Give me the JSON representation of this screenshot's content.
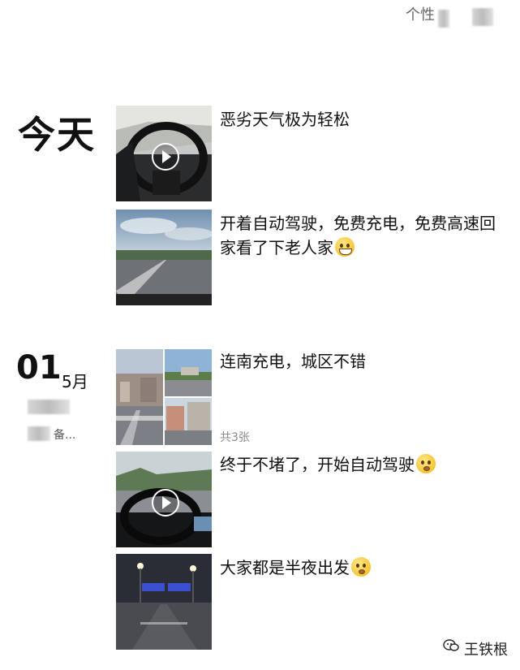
{
  "header": {
    "signature_label": "个性"
  },
  "sections": [
    {
      "day_label": "今天",
      "posts": [
        {
          "text": "恶劣天气极为轻松",
          "type": "video",
          "emoji": ""
        },
        {
          "text": "开着自动驾驶，免费充电，免费高速回家看了下老人家",
          "type": "image",
          "emoji": "grin"
        }
      ]
    },
    {
      "date_day": "01",
      "date_month": "5月",
      "location_snippet": "备...",
      "posts": [
        {
          "text": "连南充电，城区不错",
          "type": "image-grid",
          "emoji": "",
          "count": "共3张"
        },
        {
          "text": "终于不堵了，开始自动驾驶",
          "type": "video",
          "emoji": "worry"
        },
        {
          "text": "大家都是半夜出发",
          "type": "image",
          "emoji": "worry"
        }
      ]
    }
  ],
  "watermark": {
    "label": "王铁根",
    "icon": "wechat-icon"
  }
}
